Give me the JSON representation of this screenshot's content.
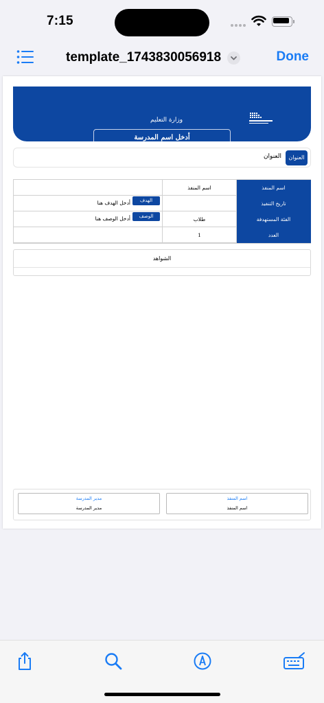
{
  "status_bar": {
    "time": "7:15"
  },
  "nav": {
    "title": "template_1743830056918",
    "done_label": "Done"
  },
  "document": {
    "ministry_name": "وزارة التعليم",
    "school_name": "أدخل اسم المدرسة",
    "title_badge": "العنوان",
    "title_value": "العنوان",
    "table": {
      "executor_label": "اسم المنفذ",
      "executor_value": "اسم المنفذ",
      "date_label": "تاريخ التنفيذ",
      "date_value": "",
      "goal_badge": "الهدف",
      "goal_value": "أدخل الهدف هنا",
      "audience_label": "الفئة المستهدفة",
      "audience_value": "طلاب",
      "desc_badge": "الوصف",
      "desc_value": "أدخل الوصف هنا",
      "count_label": "العدد",
      "count_value": "1"
    },
    "evidence_title": "الشواهد",
    "signatures": {
      "executor_label": "اسم المنفذ",
      "executor_value": "اسم المنفذ",
      "principal_label": "مدير المدرسة",
      "principal_value": "مدير المدرسة"
    }
  },
  "toolbar": {
    "icons": [
      "share-icon",
      "search-icon",
      "markup-icon",
      "keyboard-signature-icon"
    ]
  },
  "colors": {
    "accent": "#1a7cf5",
    "brand": "#0d47a1"
  }
}
